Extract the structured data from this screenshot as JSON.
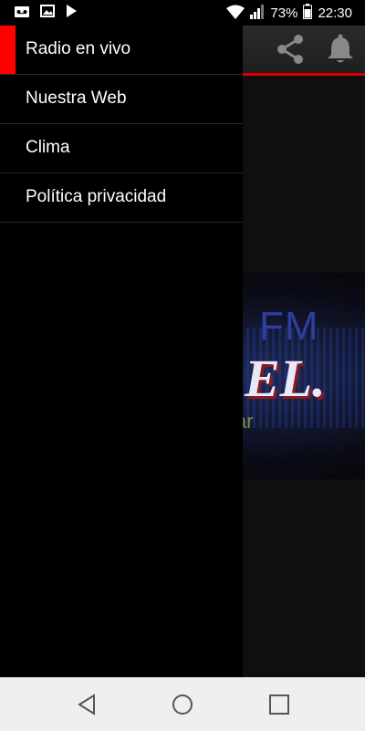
{
  "status_bar": {
    "left_icons": [
      "voicemail-icon",
      "image-icon",
      "play-icon"
    ],
    "battery_percent": "73%",
    "time": "22:30"
  },
  "drawer": {
    "items": [
      {
        "label": "Radio en vivo",
        "active": true
      },
      {
        "label": "Nuestra Web",
        "active": false
      },
      {
        "label": "Clima",
        "active": false
      },
      {
        "label": "Política privacidad",
        "active": false
      }
    ]
  },
  "toolbar": {
    "icons": [
      "share-icon",
      "bell-icon"
    ]
  },
  "hero": {
    "fm_text": "FM",
    "logo_text": "EL.",
    "sub_text": "ar"
  },
  "colors": {
    "accent": "#ff0000",
    "drawer_bg": "#000000",
    "nav_bg": "#efefef"
  },
  "nav_bar": {
    "buttons": [
      "back-icon",
      "home-icon",
      "recents-icon"
    ]
  }
}
